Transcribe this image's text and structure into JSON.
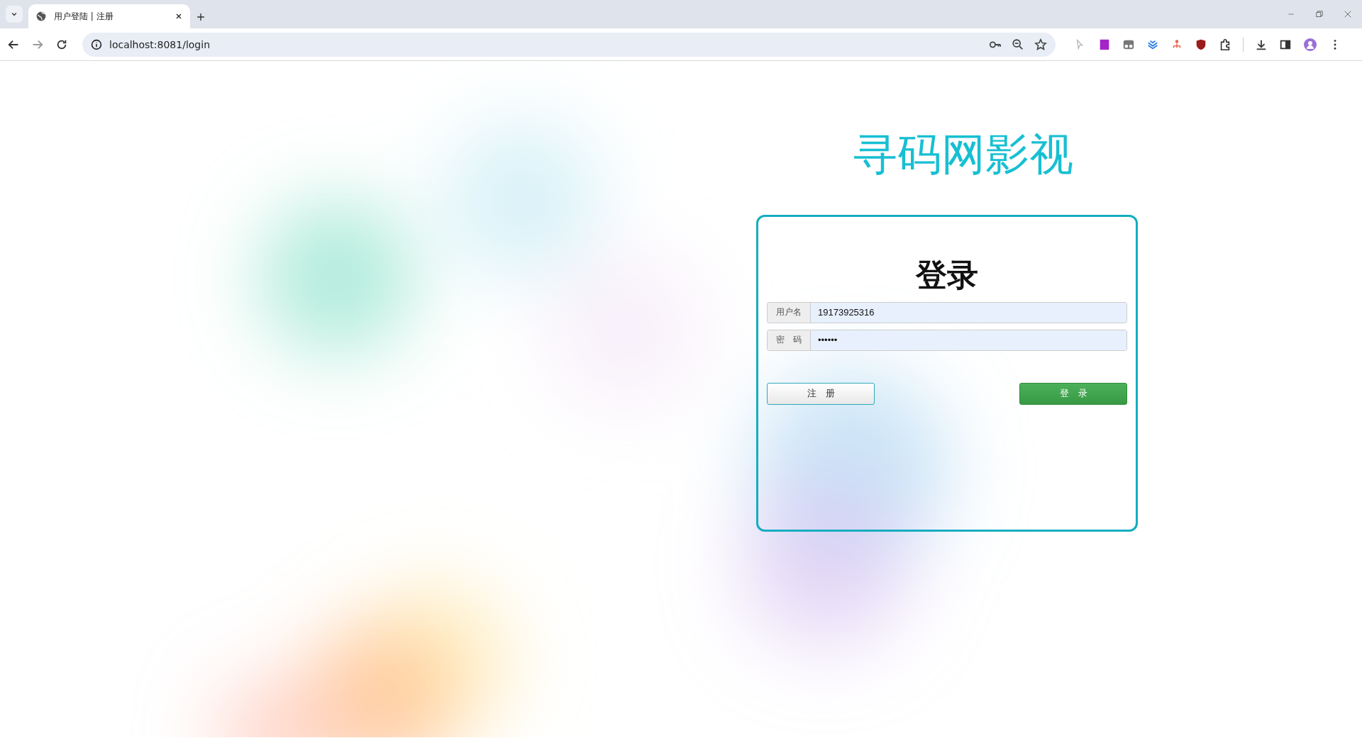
{
  "browser": {
    "tab": {
      "title": "用户登陆 | 注册",
      "selected": true
    },
    "address": "localhost:8081/login"
  },
  "page": {
    "site_title": "寻码网影视",
    "login_card": {
      "heading": "登录",
      "fields": [
        {
          "label": "用户名",
          "value": "19173925316"
        },
        {
          "label": "密　码",
          "value": "••••••"
        }
      ],
      "buttons": [
        {
          "label": "注　册",
          "kind": "secondary"
        },
        {
          "label": "登　录",
          "kind": "primary"
        }
      ]
    }
  }
}
